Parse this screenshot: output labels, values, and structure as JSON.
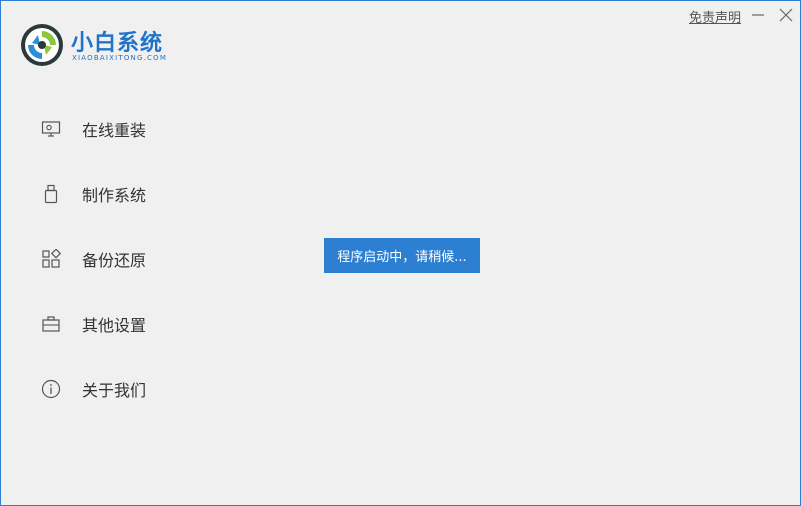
{
  "brand": {
    "title": "小白系统",
    "subtitle": "XIAOBAIXITONG.COM"
  },
  "titlebar": {
    "disclaimer_label": "免责声明",
    "minimize_icon": "minimize-icon",
    "close_icon": "close-icon"
  },
  "nav": {
    "items": [
      {
        "label": "在线重装",
        "icon": "monitor-icon"
      },
      {
        "label": "制作系统",
        "icon": "usb-drive-icon"
      },
      {
        "label": "备份还原",
        "icon": "apps-grid-icon"
      },
      {
        "label": "其他设置",
        "icon": "briefcase-icon"
      },
      {
        "label": "关于我们",
        "icon": "info-icon"
      }
    ]
  },
  "status": {
    "message": "程序启动中，请稍候..."
  },
  "colors": {
    "accent": "#2c7fd1",
    "background": "#f0f0f0",
    "text": "#333333"
  }
}
